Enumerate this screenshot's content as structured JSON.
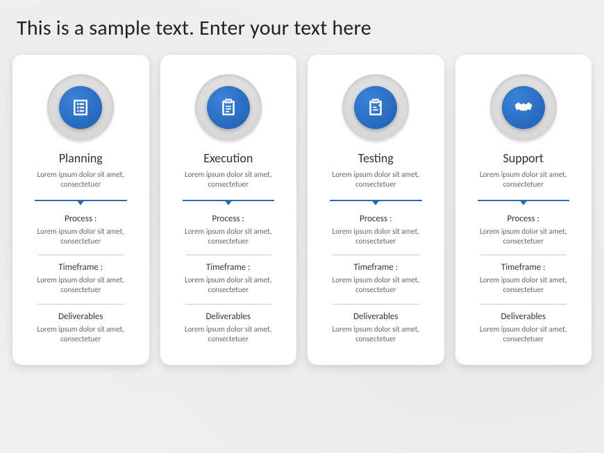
{
  "title": "This is a sample text. Enter your text here",
  "lorem": "Lorem ipsum dolor sit amet, consectetuer",
  "labels": {
    "process": "Process :",
    "timeframe": "Timeframe :",
    "deliverables": "Deliverables"
  },
  "cards": [
    {
      "title": "Planning",
      "icon": "checklist-icon"
    },
    {
      "title": "Execution",
      "icon": "clipboard-icon"
    },
    {
      "title": "Testing",
      "icon": "clipboard-check-icon"
    },
    {
      "title": "Support",
      "icon": "handshake-icon"
    }
  ]
}
